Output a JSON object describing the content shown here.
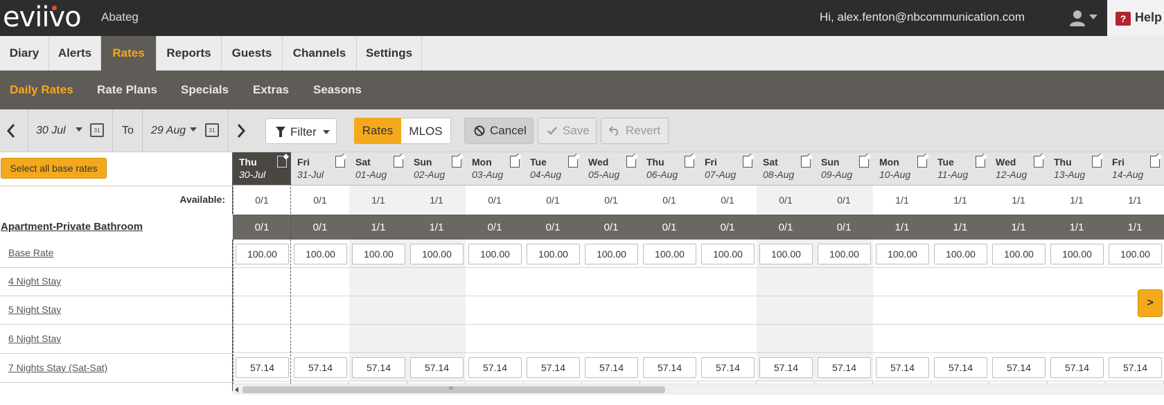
{
  "brand": {
    "logo": "eviivo",
    "property": "Abateg"
  },
  "user": {
    "greeting": "Hi, alex.fenton@nbcommunication.com",
    "icon": "user-icon"
  },
  "help": {
    "label": "Help",
    "icon": "help-icon",
    "glyph": "?"
  },
  "main_nav": [
    {
      "label": "Diary",
      "active": false
    },
    {
      "label": "Alerts",
      "active": false
    },
    {
      "label": "Rates",
      "active": true
    },
    {
      "label": "Reports",
      "active": false
    },
    {
      "label": "Guests",
      "active": false
    },
    {
      "label": "Channels",
      "active": false
    },
    {
      "label": "Settings",
      "active": false
    }
  ],
  "sub_nav": [
    {
      "label": "Daily Rates",
      "active": true
    },
    {
      "label": "Rate Plans",
      "active": false
    },
    {
      "label": "Specials",
      "active": false
    },
    {
      "label": "Extras",
      "active": false
    },
    {
      "label": "Seasons",
      "active": false
    }
  ],
  "toolbar": {
    "from_date": "30 Jul",
    "to_label": "To",
    "to_date": "29 Aug",
    "calendar_glyph": "31",
    "filter_label": "Filter",
    "view_rates": "Rates",
    "view_mlos": "MLOS",
    "cancel": "Cancel",
    "save": "Save",
    "revert": "Revert"
  },
  "grid": {
    "select_all": "Select all base rates",
    "available_label": "Available:",
    "room_name": "Apartment-Private Bathroom",
    "rate_rows": [
      "Base Rate",
      "4 Night Stay",
      "5 Night Stay",
      "6 Night Stay",
      "7 Nights Stay (Sat-Sat)"
    ],
    "next_page": ">",
    "scroll_grip": "III",
    "days": [
      {
        "name": "Thu",
        "date": "30-Jul",
        "available": "0/1",
        "room": "0/1",
        "base": "100.00",
        "seven": "57.14",
        "today": true,
        "weekend": false
      },
      {
        "name": "Fri",
        "date": "31-Jul",
        "available": "0/1",
        "room": "0/1",
        "base": "100.00",
        "seven": "57.14",
        "today": false,
        "weekend": false
      },
      {
        "name": "Sat",
        "date": "01-Aug",
        "available": "1/1",
        "room": "1/1",
        "base": "100.00",
        "seven": "57.14",
        "today": false,
        "weekend": true
      },
      {
        "name": "Sun",
        "date": "02-Aug",
        "available": "1/1",
        "room": "1/1",
        "base": "100.00",
        "seven": "57.14",
        "today": false,
        "weekend": true
      },
      {
        "name": "Mon",
        "date": "03-Aug",
        "available": "0/1",
        "room": "0/1",
        "base": "100.00",
        "seven": "57.14",
        "today": false,
        "weekend": false
      },
      {
        "name": "Tue",
        "date": "04-Aug",
        "available": "0/1",
        "room": "0/1",
        "base": "100.00",
        "seven": "57.14",
        "today": false,
        "weekend": false
      },
      {
        "name": "Wed",
        "date": "05-Aug",
        "available": "0/1",
        "room": "0/1",
        "base": "100.00",
        "seven": "57.14",
        "today": false,
        "weekend": false
      },
      {
        "name": "Thu",
        "date": "06-Aug",
        "available": "0/1",
        "room": "0/1",
        "base": "100.00",
        "seven": "57.14",
        "today": false,
        "weekend": false
      },
      {
        "name": "Fri",
        "date": "07-Aug",
        "available": "0/1",
        "room": "0/1",
        "base": "100.00",
        "seven": "57.14",
        "today": false,
        "weekend": false
      },
      {
        "name": "Sat",
        "date": "08-Aug",
        "available": "0/1",
        "room": "0/1",
        "base": "100.00",
        "seven": "57.14",
        "today": false,
        "weekend": true
      },
      {
        "name": "Sun",
        "date": "09-Aug",
        "available": "0/1",
        "room": "0/1",
        "base": "100.00",
        "seven": "57.14",
        "today": false,
        "weekend": true
      },
      {
        "name": "Mon",
        "date": "10-Aug",
        "available": "1/1",
        "room": "1/1",
        "base": "100.00",
        "seven": "57.14",
        "today": false,
        "weekend": false
      },
      {
        "name": "Tue",
        "date": "11-Aug",
        "available": "1/1",
        "room": "1/1",
        "base": "100.00",
        "seven": "57.14",
        "today": false,
        "weekend": false
      },
      {
        "name": "Wed",
        "date": "12-Aug",
        "available": "1/1",
        "room": "1/1",
        "base": "100.00",
        "seven": "57.14",
        "today": false,
        "weekend": false
      },
      {
        "name": "Thu",
        "date": "13-Aug",
        "available": "1/1",
        "room": "1/1",
        "base": "100.00",
        "seven": "57.14",
        "today": false,
        "weekend": false
      },
      {
        "name": "Fri",
        "date": "14-Aug",
        "available": "1/1",
        "room": "1/1",
        "base": "100.00",
        "seven": "57.14",
        "today": false,
        "weekend": false
      }
    ]
  },
  "colors": {
    "accent": "#f4a91c",
    "topbar": "#2d2d2d",
    "subnav": "#5f5b56",
    "room_row": "#6b6864",
    "today_header": "#4a4642",
    "help_red": "#b0242f"
  }
}
